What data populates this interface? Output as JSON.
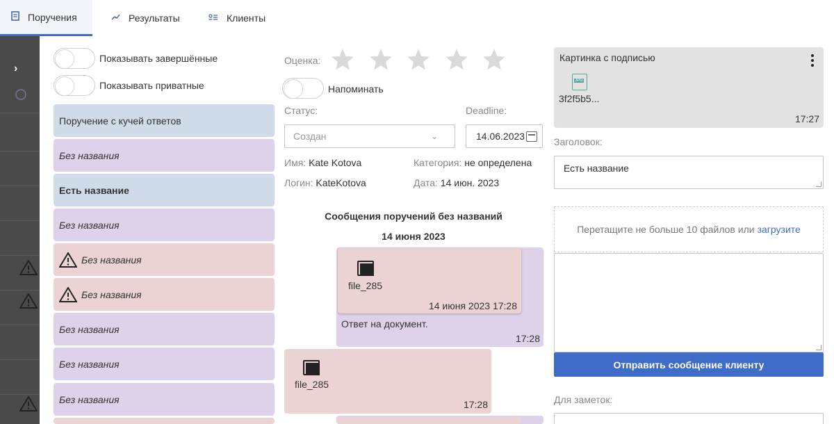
{
  "tabs": [
    {
      "label": "Поручения",
      "icon": "document-icon",
      "active": true
    },
    {
      "label": "Результаты",
      "icon": "chart-line-icon",
      "active": false
    },
    {
      "label": "Клиенты",
      "icon": "contacts-icon",
      "active": false
    }
  ],
  "filters": {
    "show_completed": "Показывать завершённые",
    "show_private": "Показывать приватные"
  },
  "tasks": [
    {
      "title": "Поручение с кучей ответов",
      "color": "#cfdbe8",
      "style": "normal",
      "warning": false
    },
    {
      "title": "Без названия",
      "color": "#ddd2ea",
      "style": "italic",
      "warning": false
    },
    {
      "title": "Есть название",
      "color": "#cfdbe8",
      "style": "bold",
      "warning": false
    },
    {
      "title": "Без названия",
      "color": "#ddd2ea",
      "style": "italic",
      "warning": false
    },
    {
      "title": "Без названия",
      "color": "#ecd3d3",
      "style": "italic",
      "warning": true
    },
    {
      "title": "Без названия",
      "color": "#ecd3d3",
      "style": "italic",
      "warning": true
    },
    {
      "title": "Без названия",
      "color": "#ddd2ea",
      "style": "italic",
      "warning": false
    },
    {
      "title": "Без названия",
      "color": "#ddd2ea",
      "style": "italic",
      "warning": false
    },
    {
      "title": "Без названия",
      "color": "#ddd2ea",
      "style": "italic",
      "warning": false
    }
  ],
  "detail": {
    "rating_label": "Оценка:",
    "rating_value": 0,
    "rating_max": 5,
    "remind_label": "Напоминать",
    "status_label": "Статус:",
    "status_value": "Создан",
    "deadline_label": "Deadline:",
    "deadline_value": "14.06.2023",
    "name_key": "Имя:",
    "name_value": "Kate Kotova",
    "login_key": "Логин:",
    "login_value": "KateKotova",
    "category_key": "Категория:",
    "category_value": "не определена",
    "date_key": "Дата:",
    "date_value": "14 июн. 2023"
  },
  "messages": {
    "section_title": "Сообщения поручений без названий",
    "date_header": "14 июня 2023",
    "items": [
      {
        "quote_file": "file_285",
        "quote_time": "14 июня 2023 17:28",
        "text": "Ответ на документ.",
        "time": "17:28"
      },
      {
        "file": "file_285",
        "time": "17:28"
      }
    ]
  },
  "right": {
    "card_title": "Картинка с подписью",
    "card_file_type": "JPG",
    "card_file_name": "3f2f5b5...",
    "card_time": "17:27",
    "title_label": "Заголовок:",
    "title_value": "Есть название",
    "drop_text": "Перетащите не больше 10 файлов или",
    "drop_link": "загрузите",
    "send_button": "Отправить сообщение клиенту",
    "notes_label": "Для заметок:"
  },
  "colors": {
    "accent": "#3f6bc9",
    "rail": "#4a4a4a",
    "task_blue": "#cfdbe8",
    "task_purple": "#ddd2ea",
    "task_red": "#ecd3d3"
  }
}
